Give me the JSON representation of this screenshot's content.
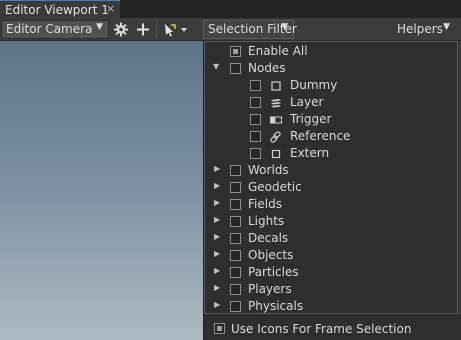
{
  "tab": {
    "title": "Editor Viewport 1",
    "close": "×"
  },
  "toolbar": {
    "camera_label": "Editor Camera",
    "caret": "▼",
    "filter_label": "Selection Filter",
    "helpers_label": "Helpers"
  },
  "filter": {
    "enable_all": {
      "label": "Enable All",
      "checked": true
    },
    "nodes": {
      "label": "Nodes",
      "expanded": true,
      "checked": false,
      "children": [
        {
          "label": "Dummy",
          "icon": "square-outline-icon"
        },
        {
          "label": "Layer",
          "icon": "layers-icon"
        },
        {
          "label": "Trigger",
          "icon": "trigger-icon"
        },
        {
          "label": "Reference",
          "icon": "link-icon"
        },
        {
          "label": "Extern",
          "icon": "square-outline-icon"
        }
      ]
    },
    "groups": [
      "Worlds",
      "Geodetic",
      "Fields",
      "Lights",
      "Decals",
      "Objects",
      "Particles",
      "Players",
      "Physicals"
    ]
  },
  "footer": {
    "label": "Use Icons For Frame Selection",
    "checked": true
  },
  "colors": {
    "accent": "#5a7aa0",
    "panel": "#2e2e2e",
    "toolbar": "#3c3c3c"
  }
}
